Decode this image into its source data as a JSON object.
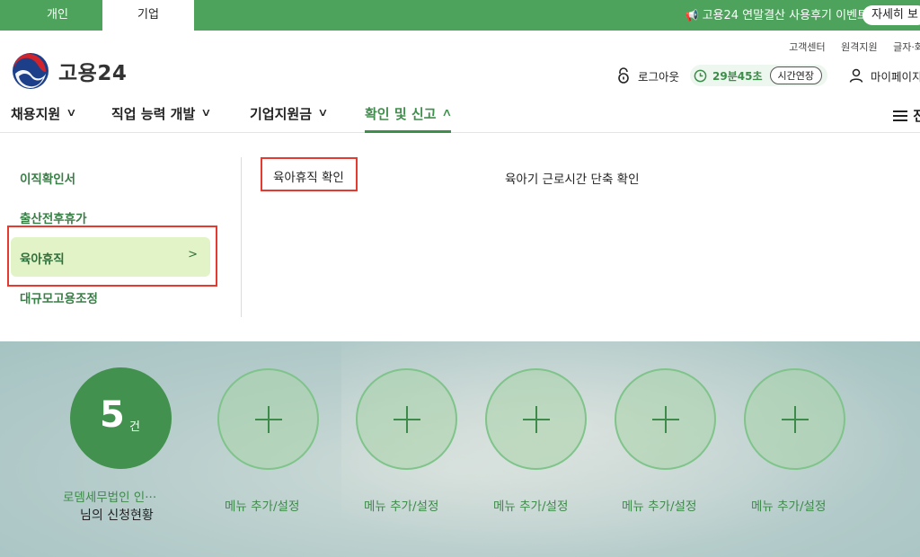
{
  "topbar": {
    "tabs": [
      {
        "label": "개인"
      },
      {
        "label": "기업"
      }
    ],
    "promo_text": "고용24 연말결산 사용후기 이벤트",
    "promo_button": "자세히 보"
  },
  "utility_links": [
    "고객센터",
    "원격지원",
    "글자·화"
  ],
  "logo": {
    "text": "고용24"
  },
  "session": {
    "logout": "로그아웃",
    "time_left": "29분45초",
    "extend": "시간연장",
    "mypage": "마이페이지"
  },
  "nav": {
    "items": [
      {
        "label": "채용지원",
        "chev": "∨"
      },
      {
        "label": "직업 능력 개발",
        "chev": "∨"
      },
      {
        "label": "기업지원금",
        "chev": "∨"
      },
      {
        "label": "확인 및 신고",
        "chev": "∧"
      }
    ],
    "all_menu": "전"
  },
  "dropdown": {
    "left_items": [
      "이직확인서",
      "출산전후휴가",
      "육아휴직",
      "대규모고용조정"
    ],
    "active_arrow": ">",
    "sub_items": [
      "육아휴직 확인",
      "육아기 근로시간 단축 확인"
    ]
  },
  "hero": {
    "count": "5",
    "count_unit": "건",
    "count_title_line1": "로뎀세무법인 인···",
    "count_title_line2": "님의 신청현황",
    "add_label": "메뉴 추가/설정"
  },
  "colors": {
    "brand_green": "#4ea35c",
    "highlight_red": "#e53a30",
    "active_bg": "#e2f4c7"
  }
}
